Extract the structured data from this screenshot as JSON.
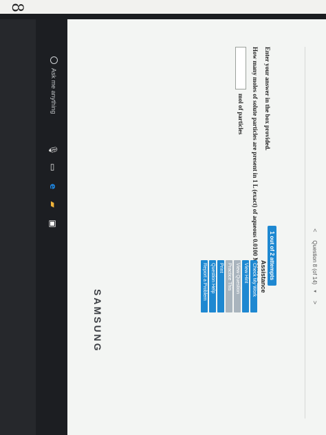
{
  "page_marker": "8.",
  "nav": {
    "prev": "<",
    "label": "Question 8 (of 14)",
    "dropdown": "▾",
    "next": ">"
  },
  "question": {
    "instructions": "Enter your answer in the box provided.",
    "prompt": "How many moles of solute particles are present in 1 L (exact) of aqueous 0.0100 M HNO₃?",
    "answer_value": "",
    "answer_unit": "mol of particles"
  },
  "attempts": "1 out of 2 attempts",
  "assistance": {
    "title": "Assistance",
    "buttons": [
      {
        "label": "Check My Work",
        "enabled": true
      },
      {
        "label": "View Hint",
        "enabled": true
      },
      {
        "label": "View Question",
        "enabled": false
      },
      {
        "label": "Practice This Question",
        "enabled": false
      },
      {
        "label": "Print",
        "enabled": true
      },
      {
        "label": "Question Help",
        "enabled": true
      },
      {
        "label": "Report a Problem",
        "enabled": true
      }
    ]
  },
  "taskbar": {
    "search_placeholder": "Ask me anything"
  },
  "brand": "SAMSUNG",
  "colors": {
    "accent": "#1e88d1",
    "disabled": "#a9b4bd"
  }
}
